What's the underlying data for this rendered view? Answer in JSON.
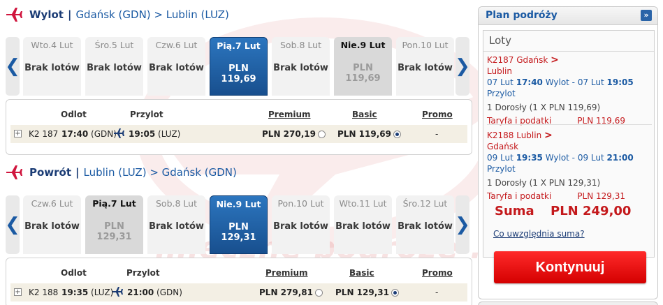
{
  "outbound": {
    "title": "Wylot",
    "separator": "|",
    "route": "Gdańsk (GDN) > Lublin (LUZ)",
    "days": [
      {
        "date": "Wto.4 Lut",
        "text": "Brak lotów",
        "state": "normal"
      },
      {
        "date": "Śro.5 Lut",
        "text": "Brak lotów",
        "state": "normal"
      },
      {
        "date": "Czw.6 Lut",
        "text": "Brak lotów",
        "state": "normal"
      },
      {
        "date": "Pią.7 Lut",
        "text": "PLN 119,69",
        "state": "selected"
      },
      {
        "date": "Sob.8 Lut",
        "text": "Brak lotów",
        "state": "normal"
      },
      {
        "date": "Nie.9 Lut",
        "text": "PLN 119,69",
        "state": "greyed"
      },
      {
        "date": "Pon.10 Lut",
        "text": "Brak lotów",
        "state": "normal"
      }
    ],
    "headers": {
      "depart": "Odlot",
      "arrive": "Przylot",
      "premium": "Premium",
      "basic": "Basic",
      "promo": "Promo"
    },
    "row": {
      "expand": "+",
      "flight": "K2 187",
      "dep_time": "17:40",
      "dep_airport": "(GDN)",
      "arr_time": "19:05",
      "arr_airport": "(LUZ)",
      "premium_price": "PLN 270,19",
      "basic_price": "PLN 119,69",
      "promo": "-",
      "selected_fare": "basic"
    }
  },
  "return": {
    "title": "Powrót",
    "separator": "|",
    "route": "Lublin (LUZ) > Gdańsk (GDN)",
    "days": [
      {
        "date": "Czw.6 Lut",
        "text": "Brak lotów",
        "state": "normal"
      },
      {
        "date": "Pią.7 Lut",
        "text": "PLN 129,31",
        "state": "greyed"
      },
      {
        "date": "Sob.8 Lut",
        "text": "Brak lotów",
        "state": "normal"
      },
      {
        "date": "Nie.9 Lut",
        "text": "PLN 129,31",
        "state": "selected"
      },
      {
        "date": "Pon.10 Lut",
        "text": "Brak lotów",
        "state": "normal"
      },
      {
        "date": "Wto.11 Lut",
        "text": "Brak lotów",
        "state": "normal"
      },
      {
        "date": "Śro.12 Lut",
        "text": "Brak lotów",
        "state": "normal"
      }
    ],
    "headers": {
      "depart": "Odlot",
      "arrive": "Przylot",
      "premium": "Premium",
      "basic": "Basic",
      "promo": "Promo"
    },
    "row": {
      "expand": "+",
      "flight": "K2 188",
      "dep_time": "19:35",
      "dep_airport": "(LUZ)",
      "arr_time": "21:00",
      "arr_airport": "(GDN)",
      "premium_price": "PLN 279,81",
      "basic_price": "PLN 129,31",
      "promo": "-",
      "selected_fare": "basic"
    }
  },
  "nav": {
    "prev": "❮",
    "next": "❯"
  },
  "plan": {
    "title": "Plan podróży",
    "toggle": "»",
    "loty_title": "Loty",
    "segments": [
      {
        "code": "K2187 Gdańsk",
        "arrow": ">",
        "dest": "Lublin",
        "date_out": "07 Lut",
        "time_out": "17:40",
        "word_out": "Wylot -",
        "date_in": "07 Lut",
        "time_in": "19:05",
        "word_in": "Przylot",
        "pax": "1 Dorosły (1 X PLN 119,69)",
        "tax_label": "Taryfa i podatki",
        "tax_value": "PLN 119,69"
      },
      {
        "code": "K2188 Lublin",
        "arrow": ">",
        "dest": "Gdańsk",
        "date_out": "09 Lut",
        "time_out": "19:35",
        "word_out": "Wylot -",
        "date_in": "09 Lut",
        "time_in": "21:00",
        "word_in": "Przylot",
        "pax": "1 Dorosły (1 X PLN 129,31)",
        "tax_label": "Taryfa i podatki",
        "tax_value": "PLN 129,31"
      }
    ],
    "sum_label": "Suma",
    "sum_value": "PLN 249,00",
    "sum_link": "Co uwzględnia suma?",
    "cta": "Kontynuuj"
  },
  "watermark": "mleczne podróże .pl",
  "colors": {
    "brand_blue": "#1b5aa3",
    "title_navy": "#1b3c75",
    "accent_red": "#c4191c",
    "cta_red": "#e00000",
    "row_bg": "#f3efe4"
  }
}
